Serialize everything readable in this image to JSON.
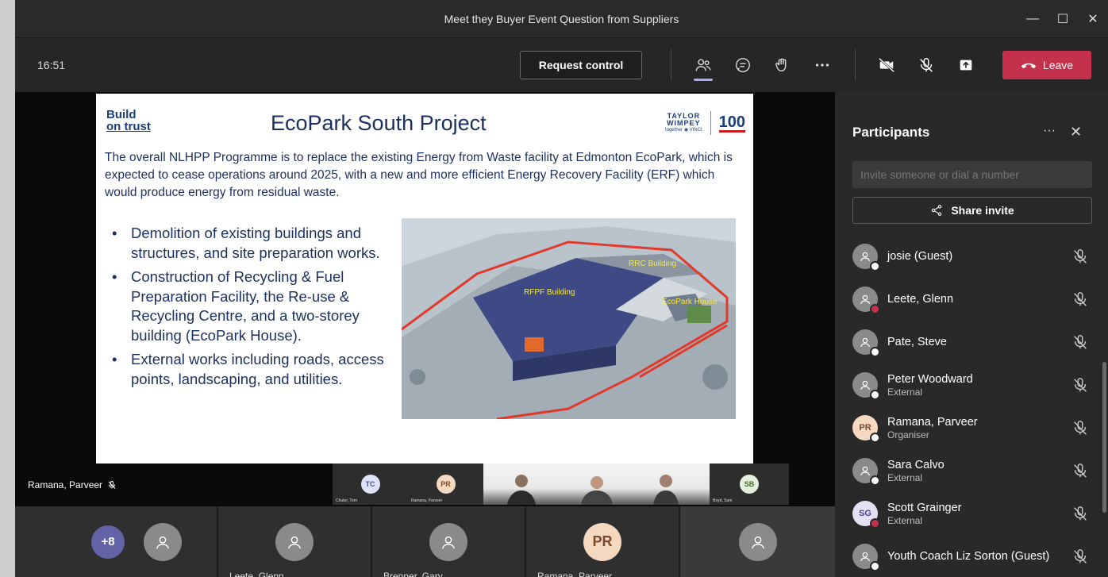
{
  "window": {
    "title": "Meet they Buyer Event Question from Suppliers",
    "controls": [
      "—",
      "☐",
      "✕"
    ]
  },
  "toolbar": {
    "clock": "16:51",
    "request_control": "Request control",
    "leave": "Leave"
  },
  "slide": {
    "logo_line1": "Build",
    "logo_line2": "on trust",
    "title": "EcoPark South Project",
    "brand_line1": "TAYLOR",
    "brand_line2": "WIMPEY",
    "brand_sub": "together ◉ VINCI",
    "brand_100": "100",
    "intro": "The overall NLHPP Programme is to replace the existing Energy from Waste facility at Edmonton EcoPark, which is expected to cease operations around 2025, with a new and more efficient Energy Recovery Facility (ERF) which would produce energy from residual waste.",
    "bullets": [
      "Demolition of existing buildings and structures, and site preparation works.",
      "Construction of Recycling & Fuel Preparation Facility, the Re-use & Recycling Centre, and a two-storey building (EcoPark House).",
      "External works including roads, access points, landscaping, and utilities."
    ],
    "image_labels": {
      "rrc": "RRC Building",
      "rfpf": "RFPF Building",
      "ecopark": "EcoPark House"
    }
  },
  "speaker": {
    "name": "Ramana, Parveer"
  },
  "thumbnails": [
    {
      "initials": "TC",
      "caption": "Chuter, Tom"
    },
    {
      "initials": "PR",
      "caption": "Ramana, Parveer"
    },
    {
      "initials": "SB",
      "caption": "Boyd, Sam"
    }
  ],
  "participants_panel": {
    "title": "Participants",
    "invite_placeholder": "Invite someone or dial a number",
    "share_invite": "Share invite",
    "people": [
      {
        "name": "josie (Guest)",
        "role": "",
        "initials": "",
        "status": "white"
      },
      {
        "name": "Leete, Glenn",
        "role": "",
        "initials": "",
        "status": "red"
      },
      {
        "name": "Pate, Steve",
        "role": "",
        "initials": "",
        "status": "white"
      },
      {
        "name": "Peter Woodward",
        "role": "External",
        "initials": "",
        "status": "white"
      },
      {
        "name": "Ramana, Parveer",
        "role": "Organiser",
        "initials": "PR",
        "status": "white"
      },
      {
        "name": "Sara Calvo",
        "role": "External",
        "initials": "",
        "status": "white"
      },
      {
        "name": "Scott Grainger",
        "role": "External",
        "initials": "SG",
        "status": "red"
      },
      {
        "name": "Youth Coach Liz Sorton (Guest)",
        "role": "",
        "initials": "",
        "status": "white"
      }
    ]
  },
  "gallery": {
    "overflow": "+8",
    "tiles": [
      {
        "name": "Leete, Glenn",
        "initials": ""
      },
      {
        "name": "Brenner, Gary",
        "initials": ""
      },
      {
        "name": "Ramana, Parveer",
        "initials": "PR"
      },
      {
        "name": "",
        "initials": ""
      }
    ]
  },
  "colors": {
    "leave": "#c4314b",
    "accent": "#6264a7",
    "panel": "#292929"
  }
}
